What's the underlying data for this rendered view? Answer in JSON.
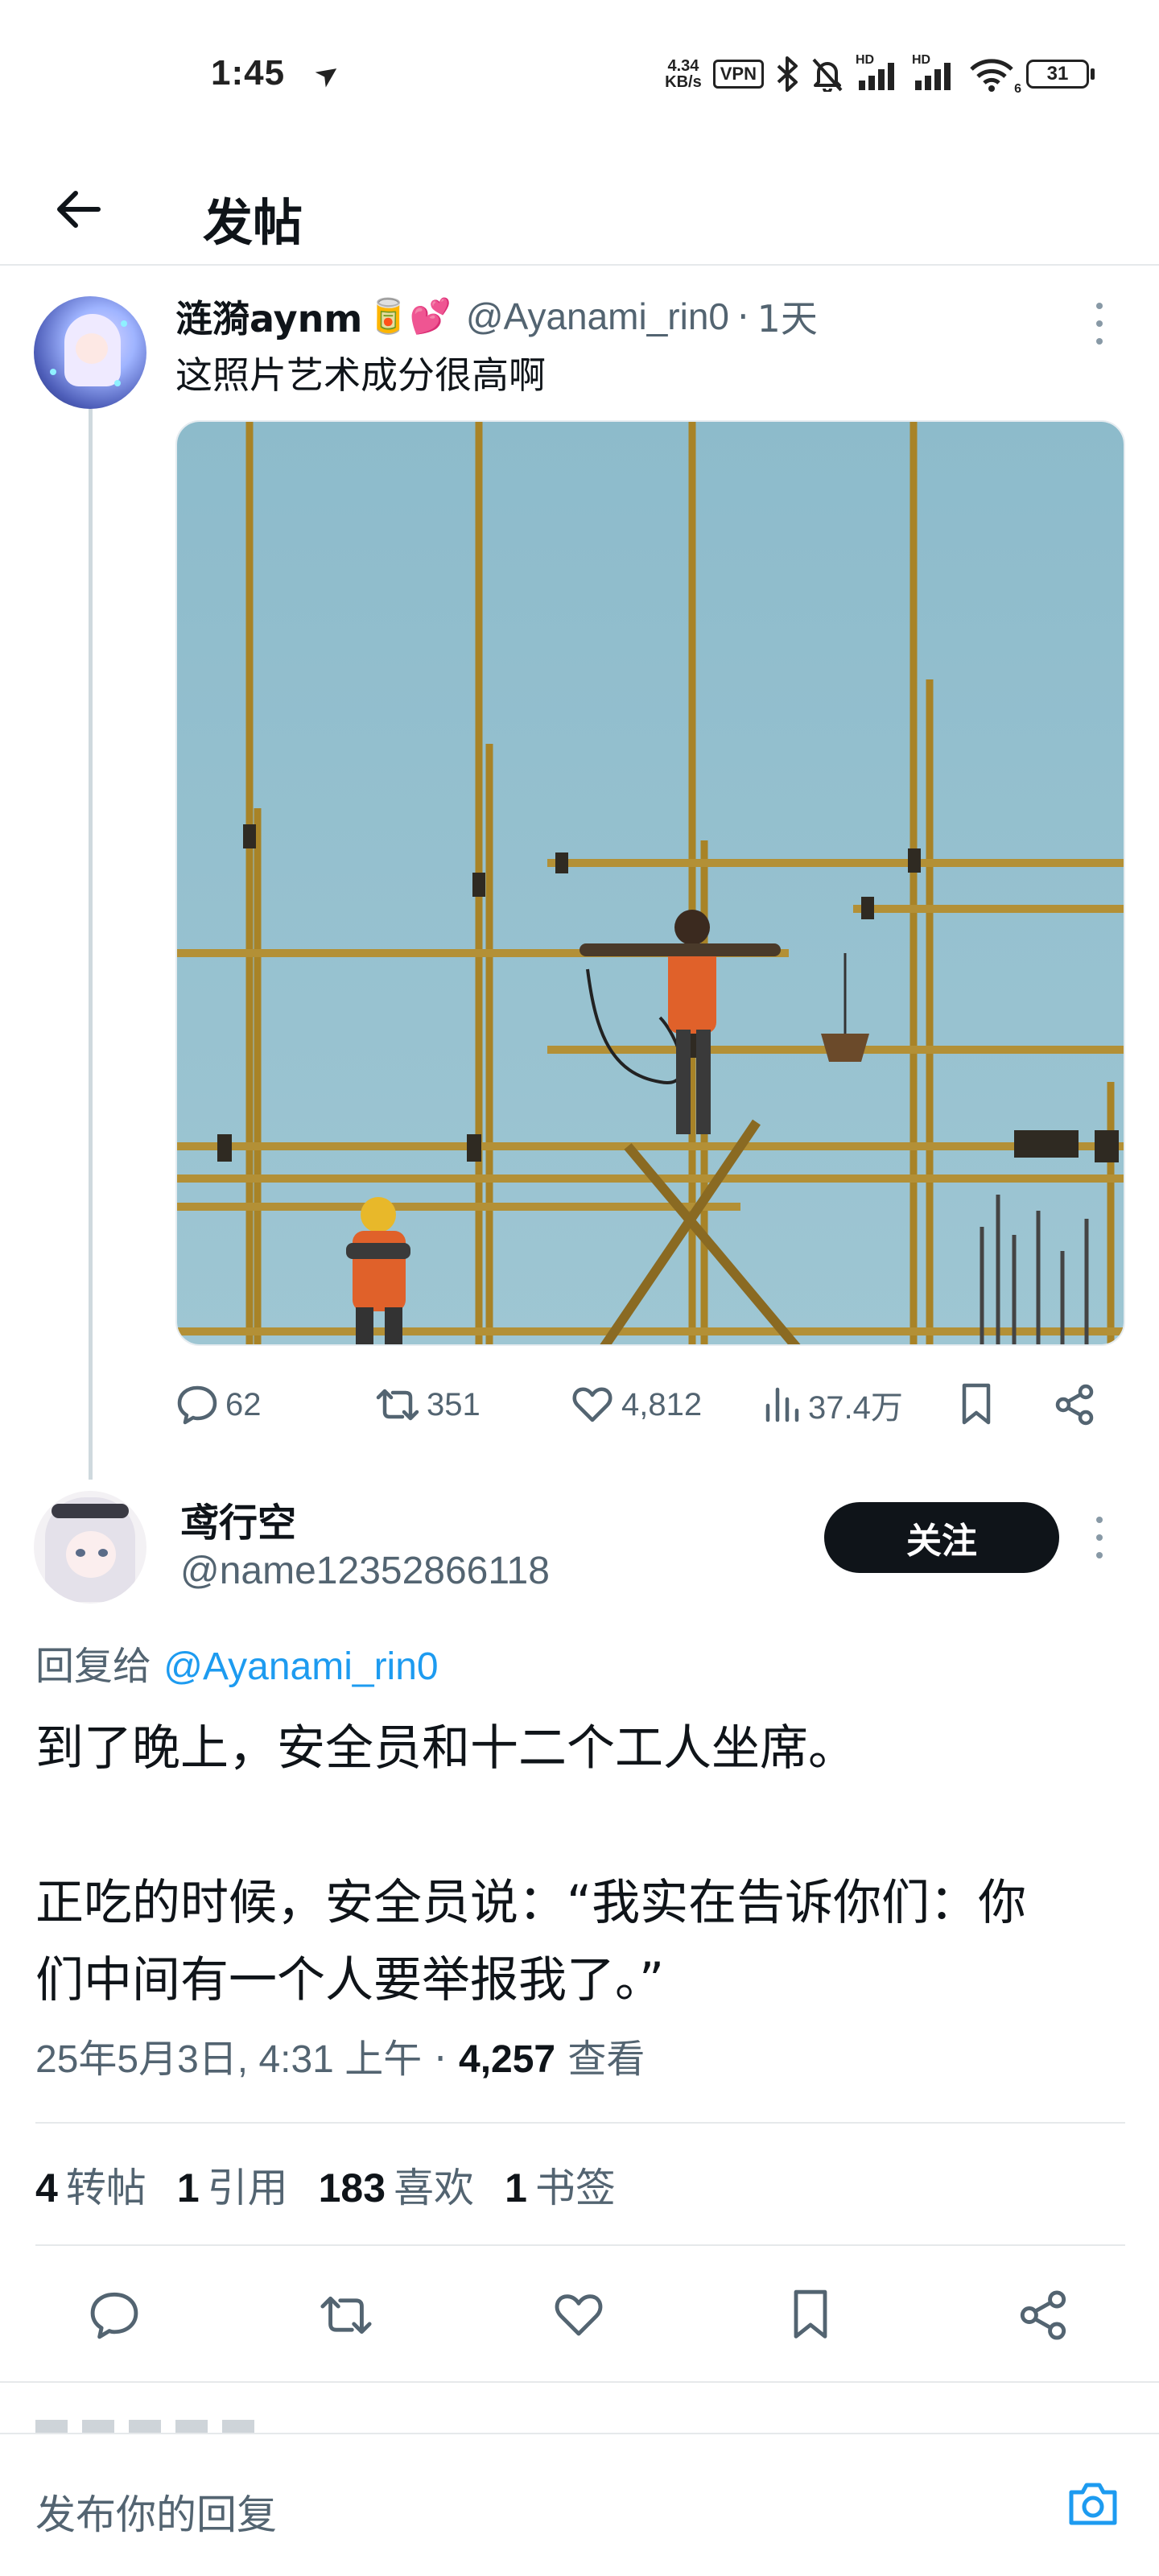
{
  "status_bar": {
    "time": "1:45",
    "net_speed_value": "4.34",
    "net_speed_unit": "KB/s",
    "vpn": "VPN",
    "hd_label": "HD",
    "wifi_band": "6",
    "battery": "31"
  },
  "header": {
    "title": "发帖"
  },
  "parent_tweet": {
    "display_name": "涟漪aynm",
    "emojis": "🥫💕",
    "handle": "@Ayanami_rin0",
    "separator": "·",
    "time": "1天",
    "text": "这照片艺术成分很高啊",
    "replies": "62",
    "retweets": "351",
    "likes": "4,812",
    "views": "37.4万"
  },
  "reply_tweet": {
    "display_name": "鸢行空",
    "handle": "@name12352866118",
    "follow_label": "关注",
    "reply_to_prefix": "回复给 ",
    "reply_to_handle": "@Ayanami_rin0",
    "body_line1": "到了晚上，安全员和十二个工人坐席。",
    "body_line2": "正吃的时候，安全员说：“我实在告诉你们：你",
    "body_line3": "们中间有一个人要举报我了。”",
    "date": "25年5月3日, 4:31 上午",
    "meta_separator": " · ",
    "view_count": "4,257",
    "view_label": " 查看",
    "stats": [
      {
        "count": "4",
        "label": "转帖"
      },
      {
        "count": "1",
        "label": "引用"
      },
      {
        "count": "183",
        "label": "喜欢"
      },
      {
        "count": "1",
        "label": "书签"
      }
    ]
  },
  "composer": {
    "placeholder": "发布你的回复"
  },
  "icons": {
    "back": "arrow-left-icon",
    "more": "more-vertical-icon",
    "reply": "speech-bubble-icon",
    "retweet": "retweet-icon",
    "like": "heart-icon",
    "views": "bar-chart-icon",
    "bookmark": "bookmark-icon",
    "share": "share-icon",
    "camera": "camera-icon"
  },
  "colors": {
    "text": "#0f1419",
    "secondary": "#536471",
    "link": "#1d9bf0",
    "follow_button_bg": "#0f1419",
    "sky": "#8fbdcd",
    "scaffold": "#b08a2c"
  }
}
